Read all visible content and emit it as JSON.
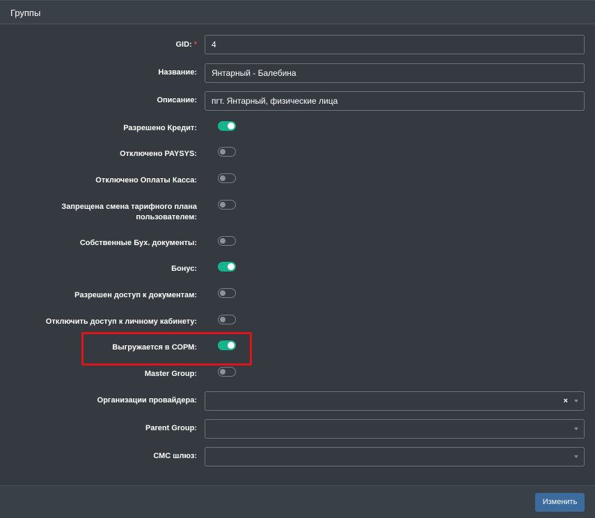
{
  "header": {
    "title": "Группы"
  },
  "fields": {
    "gid": {
      "label": "GID:",
      "required_mark": "*",
      "value": "4"
    },
    "name": {
      "label": "Название:",
      "value": "Янтарный - Балебина"
    },
    "description": {
      "label": "Описание:",
      "value": "пгт. Янтарный, физические лица"
    }
  },
  "toggles": {
    "credit_allowed": {
      "label": "Разрешено Кредит:",
      "on": true
    },
    "paysys_disabled": {
      "label": "Отключено PAYSYS:",
      "on": false
    },
    "cash_disabled": {
      "label": "Отключено Оплаты Касса:",
      "on": false
    },
    "tariff_change_forbidden": {
      "label_line1": "Запрещена смена тарифного плана",
      "label_line2": "пользователем:",
      "on": false
    },
    "own_docs": {
      "label": "Собственные Бух. документы:",
      "on": false
    },
    "bonus": {
      "label": "Бонус:",
      "on": true
    },
    "docs_access": {
      "label": "Разрешен доступ к документам:",
      "on": false
    },
    "cabinet_disabled": {
      "label": "Отключить доступ к личному кабинету:",
      "on": false
    },
    "sorm_export": {
      "label": "Выгружается в СОРМ:",
      "on": true
    },
    "master_group": {
      "label": "Master Group:",
      "on": false
    }
  },
  "selects": {
    "provider_orgs": {
      "label": "Организации провайдера:",
      "value": "",
      "clear": "×"
    },
    "parent_group": {
      "label": "Parent Group:",
      "value": ""
    },
    "sms_gateway": {
      "label": "СМС шлюз:",
      "value": ""
    }
  },
  "footer": {
    "submit_label": "Изменить"
  },
  "colors": {
    "toggle_on": "#16b48c",
    "highlight": "#e0141b",
    "button": "#3c6b9e"
  }
}
